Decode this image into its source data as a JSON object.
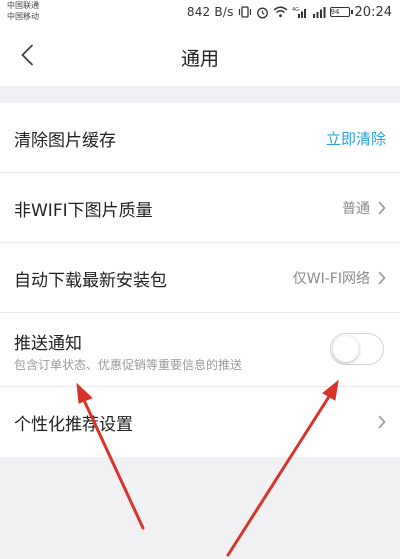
{
  "status_bar": {
    "carrier_1": "中国联通",
    "carrier_2": "中国移动",
    "net_speed": "842 B/s",
    "wifi_label": "4G",
    "battery_level": "94",
    "time": "20:24"
  },
  "header": {
    "title": "通用",
    "back_icon": "chevron-left-icon"
  },
  "settings": {
    "clear_cache": {
      "label": "清除图片缓存",
      "action": "立即清除"
    },
    "image_quality": {
      "label": "非WIFI下图片质量",
      "value": "普通"
    },
    "auto_download": {
      "label": "自动下载最新安装包",
      "value": "仅WI-FI网络"
    },
    "push": {
      "label": "推送通知",
      "description": "包含订单状态、优惠促销等重要信息的推送",
      "enabled": false
    },
    "personalized": {
      "label": "个性化推荐设置"
    }
  },
  "colors": {
    "accent": "#2aa3d8",
    "annotation_arrow": "#d9342b",
    "background": "#f1f1f3"
  }
}
